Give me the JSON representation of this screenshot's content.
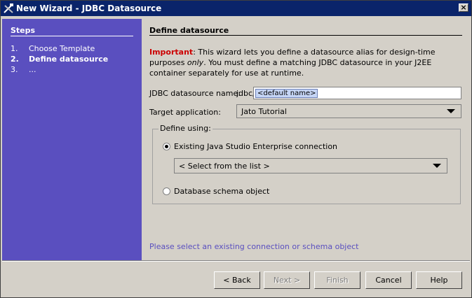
{
  "window": {
    "title": "New Wizard - JDBC Datasource",
    "close_label": "×"
  },
  "steps": {
    "header": "Steps",
    "items": [
      {
        "num": "1.",
        "label": "Choose Template"
      },
      {
        "num": "2.",
        "label": "Define datasource"
      },
      {
        "num": "3.",
        "label": "..."
      }
    ]
  },
  "content": {
    "title": "Define datasource",
    "important_label": "Important",
    "intro_1": ": This wizard lets you define a datasource alias for design-time purposes ",
    "intro_only": "only",
    "intro_2": ". You must define a matching JDBC datasource in your J2EE container separately for use at runtime.",
    "name_label": "JDBC datasource name:",
    "name_prefix": "jdbc/",
    "name_value": "<default name>",
    "target_label": "Target application:",
    "target_value": "Jato Tutorial",
    "define_using": "Define using:",
    "radio_existing": "Existing Java Studio Enterprise connection",
    "connection_value": "< Select from the list >",
    "radio_schema": "Database schema object",
    "hint": "Please select an existing connection or schema object"
  },
  "buttons": {
    "back": "< Back",
    "next": "Next >",
    "finish": "Finish",
    "cancel": "Cancel",
    "help": "Help"
  },
  "colors": {
    "titlebar": "#0a246a",
    "steps_panel": "#5a4fbf",
    "important": "#cc0000"
  }
}
